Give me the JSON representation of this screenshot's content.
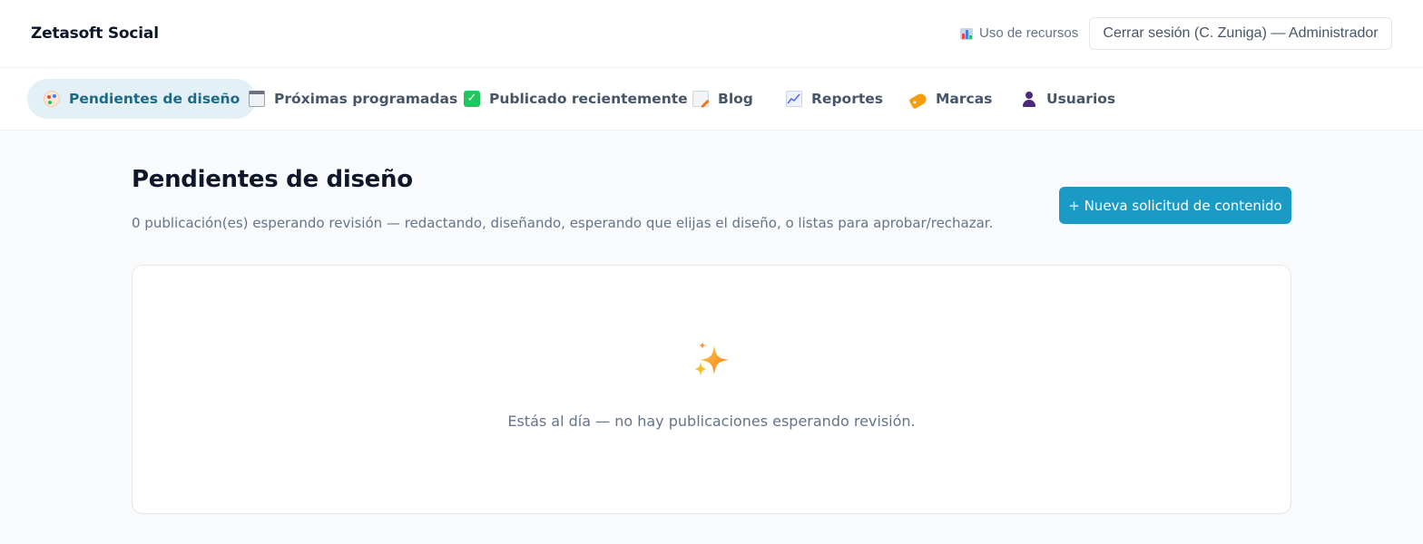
{
  "header": {
    "brand": "Zetasoft Social",
    "usage_label": "Uso de recursos",
    "usage_icon": "bar-chart-icon",
    "logout_label": "Cerrar sesión (C. Zuniga) — Administrador"
  },
  "nav": {
    "tabs": [
      {
        "label": "Pendientes de diseño",
        "icon": "palette-icon",
        "active": true
      },
      {
        "label": "Próximas programadas",
        "icon": "calendar-icon",
        "active": false
      },
      {
        "label": "Publicado recientemente",
        "icon": "check-icon",
        "active": false
      },
      {
        "label": "Blog",
        "icon": "memo-icon",
        "active": false
      },
      {
        "label": "Reportes",
        "icon": "line-chart-icon",
        "active": false
      },
      {
        "label": "Marcas",
        "icon": "tag-icon",
        "active": false
      },
      {
        "label": "Usuarios",
        "icon": "user-icon",
        "active": false
      }
    ]
  },
  "main": {
    "title": "Pendientes de diseño",
    "subtitle": "0 publicación(es) esperando revisión — redactando, diseñando, esperando que elijas el diseño, o listas para aprobar/rechazar.",
    "new_request_label": "+ Nueva solicitud de contenido",
    "empty_state": {
      "icon": "sparkles-icon",
      "message": "Estás al día — no hay publicaciones esperando revisión."
    }
  },
  "colors": {
    "accent": "#1a9bc6",
    "active_tab_bg": "#e3f1f7",
    "active_tab_text": "#1e6a86"
  }
}
